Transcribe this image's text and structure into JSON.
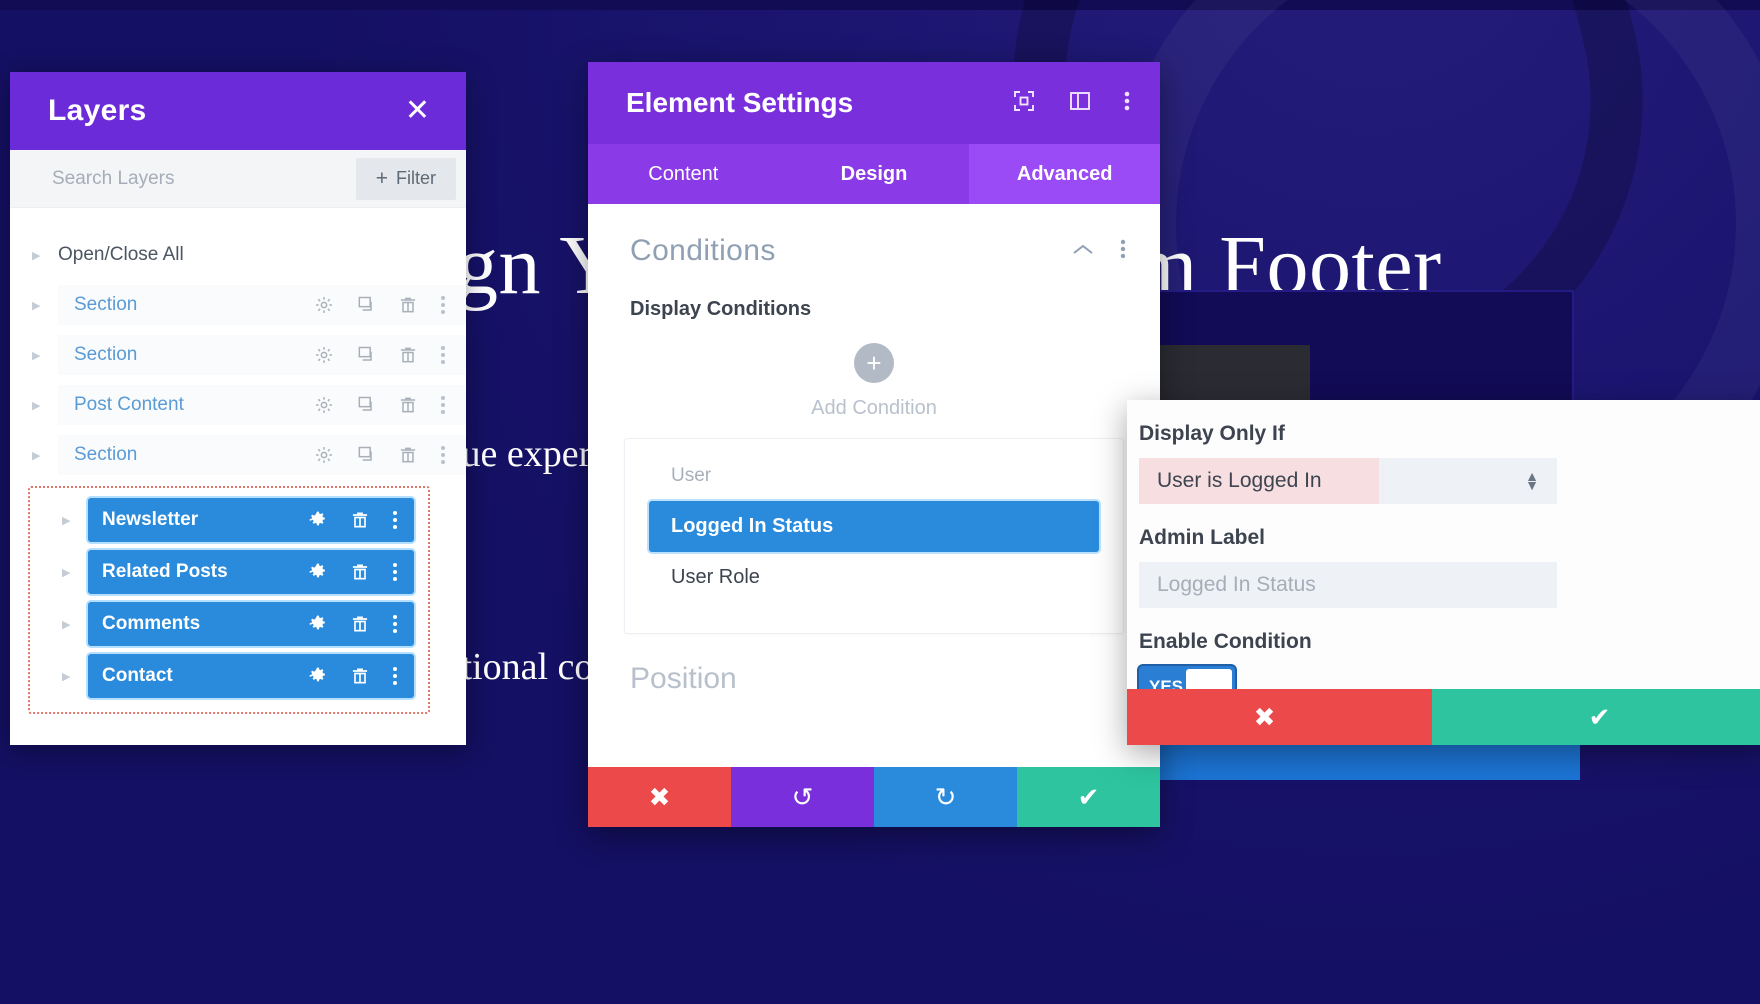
{
  "background": {
    "headline": "Design Your Own Custom Footer",
    "sub1": "Build unique experiences",
    "sub2": "with conditional content"
  },
  "layers_panel": {
    "title": "Layers",
    "close_icon": "close-icon",
    "search_placeholder": "Search Layers",
    "filter_label": "Filter",
    "filter_plus": "+",
    "open_close_all": "Open/Close All",
    "rows": [
      {
        "name": "Section",
        "link": true
      },
      {
        "name": "Section",
        "link": true
      },
      {
        "name": "Post Content",
        "link": true
      },
      {
        "name": "Section",
        "link": true
      }
    ],
    "selected_rows": [
      {
        "name": "Newsletter"
      },
      {
        "name": "Related Posts"
      },
      {
        "name": "Comments"
      },
      {
        "name": "Contact"
      }
    ],
    "row_icons": [
      "gear-icon",
      "duplicate-icon",
      "trash-icon",
      "more-vertical-icon"
    ],
    "selected_row_icons": [
      "gear-icon",
      "trash-icon",
      "more-vertical-icon"
    ]
  },
  "settings_panel": {
    "title": "Element Settings",
    "header_icons": [
      "responsive-view-icon",
      "layout-panel-icon",
      "more-vertical-icon"
    ],
    "tabs": [
      {
        "label": "Content",
        "active": false
      },
      {
        "label": "Design",
        "active": false
      },
      {
        "label": "Advanced",
        "active": true
      }
    ],
    "section_title": "Conditions",
    "collapse_icon": "chevron-up-icon",
    "section_menu_icon": "more-vertical-icon",
    "display_conditions_label": "Display Conditions",
    "add_condition_label": "Add Condition",
    "add_condition_plus": "+",
    "options_group": "User",
    "options": [
      {
        "label": "Logged In Status",
        "selected": true
      },
      {
        "label": "User Role",
        "selected": false
      }
    ],
    "next_section_title": "Position",
    "footer_buttons": [
      {
        "name": "cancel",
        "glyph": "✖"
      },
      {
        "name": "undo",
        "glyph": "↺"
      },
      {
        "name": "redo",
        "glyph": "↻"
      },
      {
        "name": "save",
        "glyph": "✔"
      }
    ]
  },
  "condition_popup": {
    "display_only_if_label": "Display Only If",
    "display_only_if_value": "User is Logged In",
    "admin_label_label": "Admin Label",
    "admin_label_placeholder": "Logged In Status",
    "enable_condition_label": "Enable Condition",
    "toggle_value": "YES",
    "footer_buttons": [
      {
        "name": "cancel",
        "glyph": "✖"
      },
      {
        "name": "save",
        "glyph": "✔"
      }
    ]
  },
  "colors": {
    "purple_header": "#6c2bd9",
    "settings_header": "#7a2fdc",
    "tab_active": "#9a4bf5",
    "selected_blue": "#2a8bdd",
    "danger_red": "#ec4a4a",
    "success_green": "#2ec4a0",
    "dashed_outline": "#e0766a",
    "value_pink": "#f7dfe1"
  }
}
